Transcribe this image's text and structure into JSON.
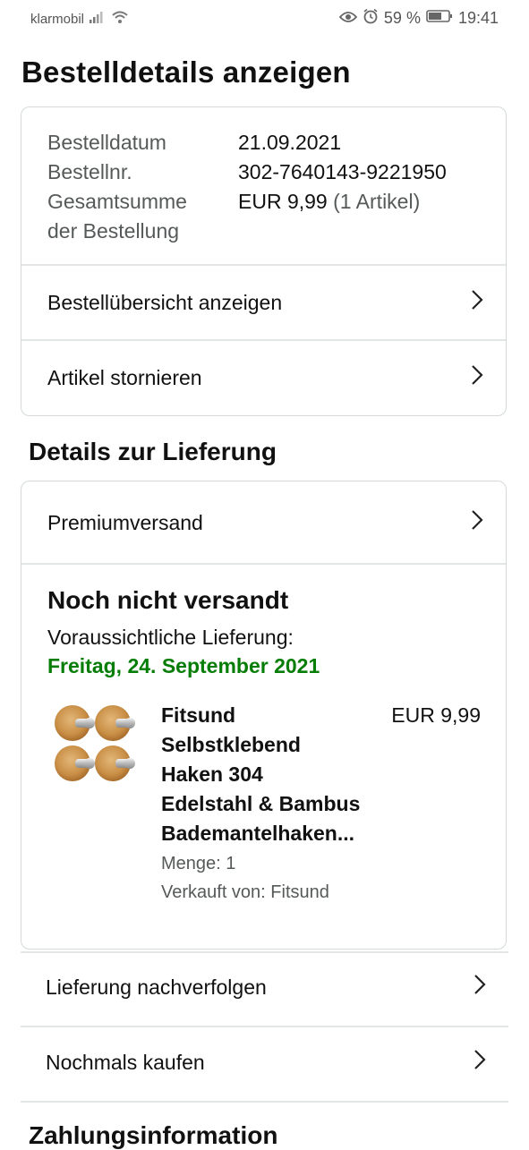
{
  "status_bar": {
    "carrier": "klarmobil",
    "battery": "59 %",
    "time": "19:41"
  },
  "page_title": "Bestelldetails anzeigen",
  "order_summary": {
    "date_label": "Bestelldatum",
    "date_value": "21.09.2021",
    "number_label": "Bestellnr.",
    "number_value": "302-7640143-9221950",
    "total_label_1": "Gesamtsumme",
    "total_label_2": "der Bestellung",
    "total_value": "EUR 9,99",
    "total_count": "(1 Artikel)",
    "view_summary": "Bestellübersicht anzeigen",
    "cancel_items": "Artikel stornieren"
  },
  "delivery": {
    "section_title": "Details zur Lieferung",
    "shipping_method": "Premiumversand",
    "status": "Noch nicht versandt",
    "estimated_label": "Voraussichtliche Lieferung:",
    "estimated_date": "Freitag, 24. September 2021",
    "product": {
      "title_lines": [
        "Fitsund",
        "Selbstklebend",
        "Haken 304",
        "Edelstahl & Bambus",
        "Bademantelhaken..."
      ],
      "price": "EUR 9,99",
      "quantity": "Menge: 1",
      "seller": "Verkauft von: Fitsund"
    }
  },
  "actions": {
    "track": "Lieferung nachverfolgen",
    "buy_again": "Nochmals kaufen"
  },
  "payment_title": "Zahlungsinformation",
  "colors": {
    "delivery_green": "#067d06",
    "border": "#d5d9d9"
  }
}
